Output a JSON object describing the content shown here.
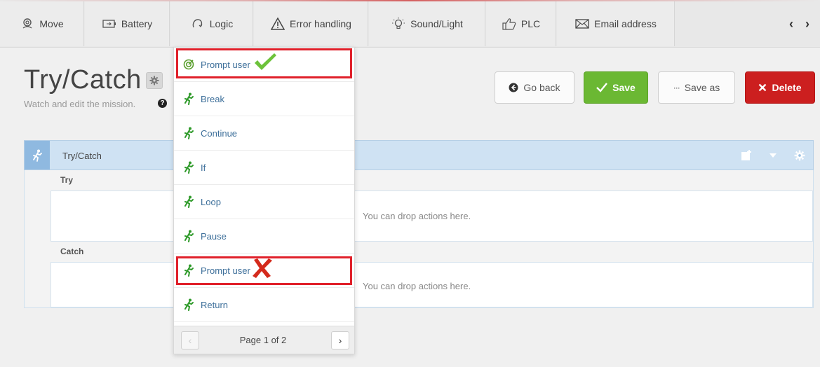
{
  "tabs": [
    {
      "label": "Move",
      "icon": "location-pin-icon"
    },
    {
      "label": "Battery",
      "icon": "battery-icon"
    },
    {
      "label": "Logic",
      "icon": "logic-icon"
    },
    {
      "label": "Error handling",
      "icon": "warning-icon"
    },
    {
      "label": "Sound/Light",
      "icon": "lightbulb-icon"
    },
    {
      "label": "PLC",
      "icon": "thumbs-up-icon"
    },
    {
      "label": "Email address",
      "icon": "envelope-icon"
    }
  ],
  "tab_nav": {
    "prev": "‹",
    "next": "›"
  },
  "page": {
    "title": "Try/Catch",
    "subtitle": "Watch and edit the mission."
  },
  "actions": {
    "go_back": "Go back",
    "save": "Save",
    "save_as": "Save as",
    "delete": "Delete"
  },
  "block": {
    "title": "Try/Catch",
    "try_label": "Try",
    "catch_label": "Catch",
    "drop_hint_try": "You can drop actions here.",
    "drop_hint_catch": "You can drop actions here."
  },
  "dropdown": {
    "items": [
      {
        "label": "Prompt user",
        "icon": "target-icon",
        "mark": "correct"
      },
      {
        "label": "Break",
        "icon": "runner-icon"
      },
      {
        "label": "Continue",
        "icon": "runner-icon"
      },
      {
        "label": "If",
        "icon": "runner-icon"
      },
      {
        "label": "Loop",
        "icon": "runner-icon"
      },
      {
        "label": "Pause",
        "icon": "runner-icon"
      },
      {
        "label": "Prompt user",
        "icon": "runner-icon",
        "mark": "wrong"
      },
      {
        "label": "Return",
        "icon": "runner-icon"
      }
    ],
    "pagination": "Page 1 of 2"
  },
  "colors": {
    "accent_green": "#6bb833",
    "danger_red": "#cc1f1f",
    "highlight_red": "#e0202a",
    "link_blue": "#3d6f9a"
  }
}
